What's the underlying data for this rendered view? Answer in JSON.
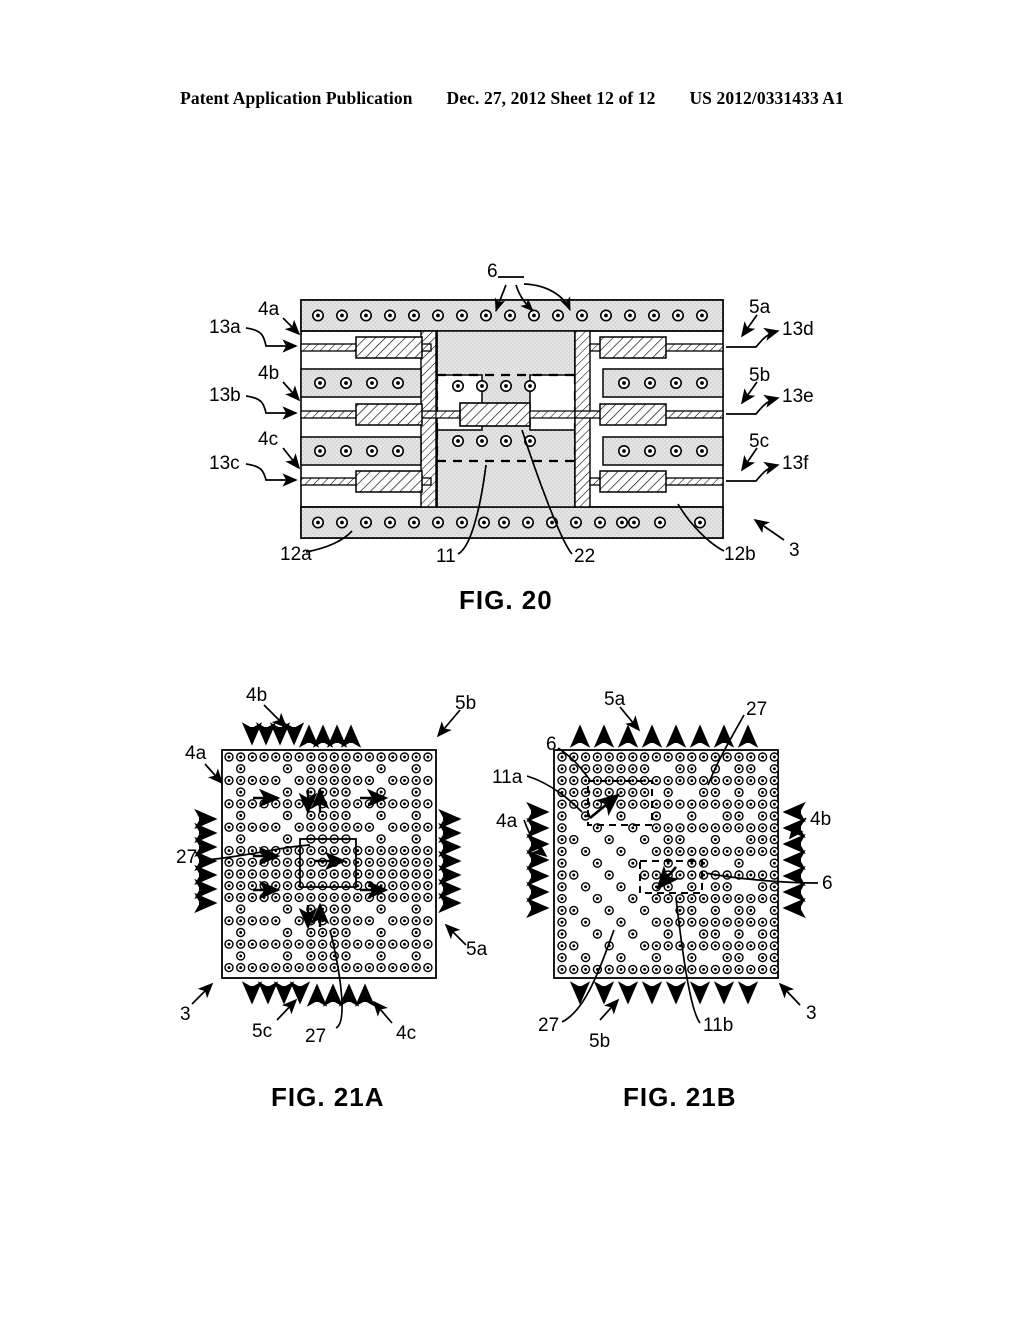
{
  "header": {
    "publication": "Patent Application Publication",
    "date_sheet": "Dec. 27, 2012  Sheet 12 of 12",
    "pub_number": "US 2012/0331433 A1"
  },
  "figures": [
    {
      "id": "fig20",
      "caption": "FIG. 20",
      "description": "Cross-sectional view of multilayer circuit board showing signal traces, ground planes with vias, and central via-fence region",
      "labels": {
        "left": [
          {
            "name": "4a",
            "text": "4a"
          },
          {
            "name": "13a",
            "text": "13a"
          },
          {
            "name": "4b",
            "text": "4b"
          },
          {
            "name": "13b",
            "text": "13b"
          },
          {
            "name": "4c",
            "text": "4c"
          },
          {
            "name": "13c",
            "text": "13c"
          }
        ],
        "right": [
          {
            "name": "5a",
            "text": "5a"
          },
          {
            "name": "13d",
            "text": "13d"
          },
          {
            "name": "5b",
            "text": "5b"
          },
          {
            "name": "13e",
            "text": "13e"
          },
          {
            "name": "5c",
            "text": "5c"
          },
          {
            "name": "13f",
            "text": "13f"
          }
        ],
        "top": [
          {
            "name": "6",
            "text": "6"
          }
        ],
        "bottom": [
          {
            "name": "12a",
            "text": "12a"
          },
          {
            "name": "11",
            "text": "11"
          },
          {
            "name": "22",
            "text": "22"
          },
          {
            "name": "12b",
            "text": "12b"
          },
          {
            "name": "3",
            "text": "3"
          }
        ]
      }
    },
    {
      "id": "fig21a",
      "caption": "FIG. 21A",
      "description": "Plan view of via array with orthogonal channel routing and signal direction arrows",
      "labels": {
        "top": [
          {
            "name": "4b",
            "text": "4b"
          },
          {
            "name": "5b",
            "text": "5b"
          }
        ],
        "left": [
          {
            "name": "4a",
            "text": "4a"
          },
          {
            "name": "27",
            "text": "27"
          }
        ],
        "right": [
          {
            "name": "5a",
            "text": "5a"
          }
        ],
        "bottom": [
          {
            "name": "3",
            "text": "3"
          },
          {
            "name": "5c",
            "text": "5c"
          },
          {
            "name": "27",
            "text": "27"
          },
          {
            "name": "4c",
            "text": "4c"
          }
        ]
      }
    },
    {
      "id": "fig21b",
      "caption": "FIG. 21B",
      "description": "Plan view of via array with diagonal routing channels and signal direction arrows",
      "labels": {
        "top": [
          {
            "name": "5a",
            "text": "5a"
          },
          {
            "name": "27",
            "text": "27"
          },
          {
            "name": "6",
            "text": "6"
          }
        ],
        "left": [
          {
            "name": "11a",
            "text": "11a"
          },
          {
            "name": "4a",
            "text": "4a"
          }
        ],
        "right": [
          {
            "name": "4b",
            "text": "4b"
          },
          {
            "name": "6",
            "text": "6"
          }
        ],
        "bottom": [
          {
            "name": "27",
            "text": "27"
          },
          {
            "name": "5b",
            "text": "5b"
          },
          {
            "name": "11b",
            "text": "11b"
          },
          {
            "name": "3",
            "text": "3"
          }
        ]
      }
    }
  ],
  "colors": {
    "ink": "#000000",
    "paper": "#ffffff",
    "stipple": "#d9d9d9",
    "hatch": "#ffffff"
  }
}
